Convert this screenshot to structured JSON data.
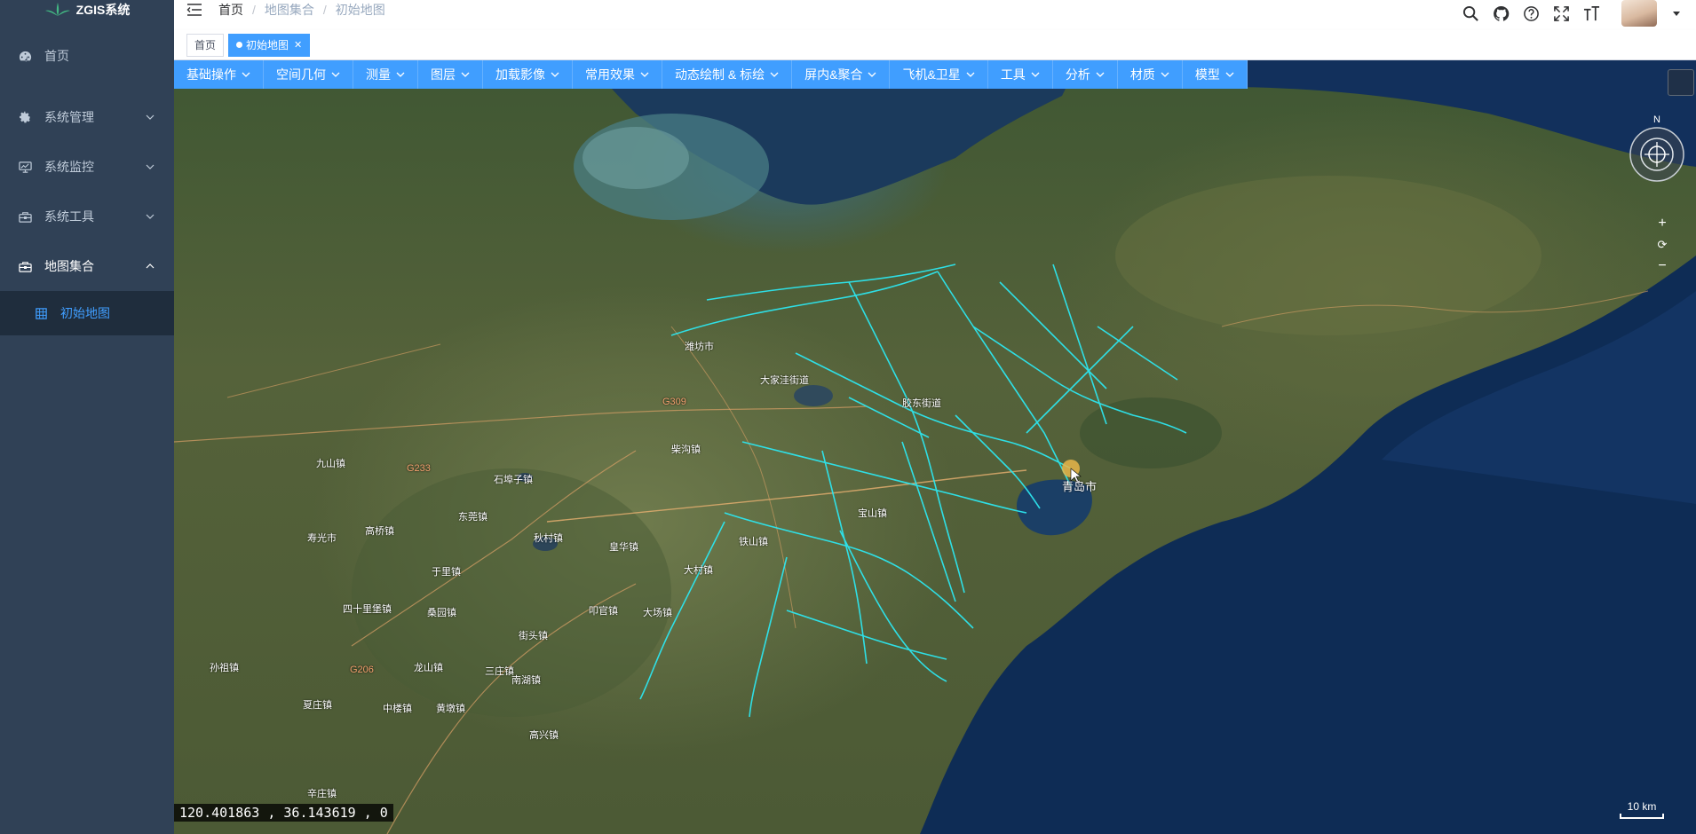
{
  "app": {
    "logo_text": "ZGIS系统"
  },
  "sidebar": {
    "items": [
      {
        "label": "首页",
        "icon": "dashboard-icon"
      },
      {
        "label": "系统管理",
        "icon": "gear-icon"
      },
      {
        "label": "系统监控",
        "icon": "monitor-icon"
      },
      {
        "label": "系统工具",
        "icon": "toolbox-icon"
      },
      {
        "label": "地图集合",
        "icon": "toolbox-icon"
      }
    ],
    "submenu": [
      {
        "label": "初始地图",
        "icon": "grid-icon"
      }
    ]
  },
  "breadcrumb": [
    "首页",
    "地图集合",
    "初始地图"
  ],
  "tags": [
    {
      "label": "首页",
      "active": false
    },
    {
      "label": "初始地图",
      "active": true
    }
  ],
  "toolbar": {
    "row1": [
      "基础操作",
      "空间几何",
      "测量",
      "图层",
      "加载影像",
      "常用效果",
      "动态绘制 & 标绘",
      "屏内&聚合",
      "飞机&卫星",
      "工具",
      "分析",
      "材质"
    ],
    "row2": [
      "模型"
    ]
  },
  "map": {
    "coordinates": "120.401863 ,  36.143619 ,  0",
    "scale": "10 km",
    "compass_north": "N",
    "zoom_in": "+",
    "zoom_reset": "⟳",
    "zoom_out": "−",
    "labels": [
      {
        "text": "青岛市",
        "kind": "city"
      },
      {
        "text": "潍坊市",
        "kind": "town"
      },
      {
        "text": "大家洼街道",
        "kind": "town"
      },
      {
        "text": "宝山镇",
        "kind": "town"
      },
      {
        "text": "胶东街道",
        "kind": "town"
      },
      {
        "text": "九山镇",
        "kind": "town"
      },
      {
        "text": "高桥镇",
        "kind": "town"
      },
      {
        "text": "于里镇",
        "kind": "town"
      },
      {
        "text": "石埠子镇",
        "kind": "town"
      },
      {
        "text": "柴沟镇",
        "kind": "town"
      },
      {
        "text": "皇华镇",
        "kind": "town"
      },
      {
        "text": "街头镇",
        "kind": "town"
      },
      {
        "text": "三庄镇",
        "kind": "town"
      },
      {
        "text": "龙山镇",
        "kind": "town"
      },
      {
        "text": "南湖镇",
        "kind": "town"
      },
      {
        "text": "高兴镇",
        "kind": "town"
      },
      {
        "text": "夏庄镇",
        "kind": "town"
      },
      {
        "text": "中楼镇",
        "kind": "town"
      },
      {
        "text": "黄墩镇",
        "kind": "town"
      },
      {
        "text": "大村镇",
        "kind": "town"
      },
      {
        "text": "桑园镇",
        "kind": "town"
      },
      {
        "text": "四十里堡镇",
        "kind": "town"
      },
      {
        "text": "孙祖镇",
        "kind": "town"
      },
      {
        "text": "G206",
        "kind": "road"
      },
      {
        "text": "G309",
        "kind": "road"
      },
      {
        "text": "G233",
        "kind": "road"
      },
      {
        "text": "叩官镇",
        "kind": "town"
      },
      {
        "text": "大场镇",
        "kind": "town"
      },
      {
        "text": "铁山镇",
        "kind": "town"
      },
      {
        "text": "秋村镇",
        "kind": "town"
      },
      {
        "text": "东莞镇",
        "kind": "town"
      },
      {
        "text": "寿光市",
        "kind": "town"
      },
      {
        "text": "辛庄镇",
        "kind": "town"
      }
    ]
  },
  "colors": {
    "sidebar_bg": "#304156",
    "accent": "#409eff",
    "pipeline": "#2de6ef"
  }
}
